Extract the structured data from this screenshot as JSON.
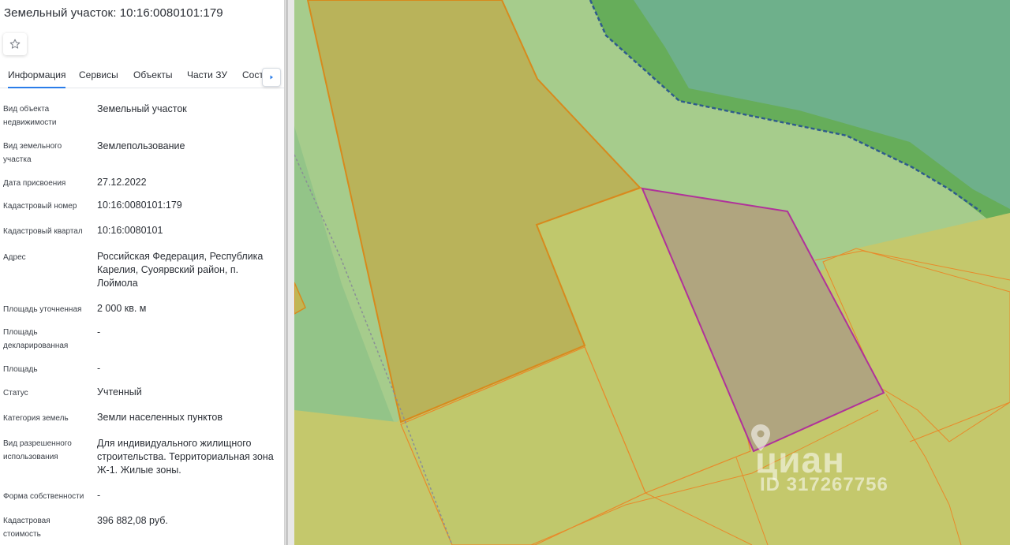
{
  "header": {
    "title": "Земельный участок: 10:16:0080101:179"
  },
  "tabs": [
    {
      "label": "Информация"
    },
    {
      "label": "Сервисы"
    },
    {
      "label": "Объекты"
    },
    {
      "label": "Части ЗУ"
    },
    {
      "label": "Состав"
    }
  ],
  "props": [
    {
      "label": "Вид объекта недвижимости",
      "value": "Земельный участок"
    },
    {
      "label": "Вид земельного участка",
      "value": "Землепользование"
    },
    {
      "label": "Дата присвоения",
      "value": "27.12.2022"
    },
    {
      "label": "Кадастровый номер",
      "value": "10:16:0080101:179"
    },
    {
      "label": "Кадастровый квартал",
      "value": "10:16:0080101"
    },
    {
      "label": "Адрес",
      "value": "Российская Федерация, Республика Карелия, Суоярвский район, п. Лоймола"
    },
    {
      "label": "Площадь уточненная",
      "value": "2 000 кв. м"
    },
    {
      "label": "Площадь декларированная",
      "value": "-"
    },
    {
      "label": "Площадь",
      "value": "-"
    },
    {
      "label": "Статус",
      "value": "Учтенный"
    },
    {
      "label": "Категория земель",
      "value": "Земли населенных пунктов"
    },
    {
      "label": "Вид разрешенного использования",
      "value": "Для индивидуального жилищного строительства. Территориальная зона Ж-1. Жилые зоны."
    },
    {
      "label": "Форма собственности",
      "value": "-"
    },
    {
      "label": "Кадастровая стоимость",
      "value": "396 882,08 руб."
    }
  ],
  "watermark": {
    "brand": "циан",
    "id": "ID 317267756"
  },
  "colors": {
    "accent": "#2b7de9",
    "selected_parcel_border": "#b0329a",
    "parcel_border": "#e88a2a"
  },
  "icons": {
    "favorite": "star-icon",
    "tabs_scroll": "chevron-right-icon"
  }
}
